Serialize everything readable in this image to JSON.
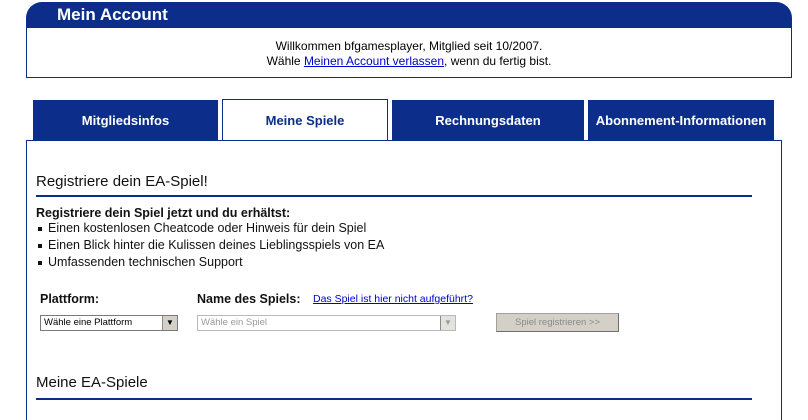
{
  "header": {
    "title": "Mein Account"
  },
  "welcome": {
    "line1": "Willkommen bfgamesplayer, Mitglied seit 10/2007.",
    "line2_prefix": "Wähle ",
    "line2_link": "Meinen Account verlassen",
    "line2_suffix": ", wenn du fertig bist."
  },
  "tabs": [
    {
      "label": "Mitgliedsinfos",
      "active": false
    },
    {
      "label": "Meine Spiele",
      "active": true
    },
    {
      "label": "Rechnungsdaten",
      "active": false
    },
    {
      "label": "Abonnement-Informationen",
      "active": false
    }
  ],
  "register": {
    "heading": "Registriere dein EA-Spiel!",
    "intro": "Registriere dein Spiel jetzt und du erhältst:",
    "benefits": [
      "Einen kostenlosen Cheatcode oder Hinweis für dein Spiel",
      "Einen Blick hinter die Kulissen deines Lieblingsspiels von EA",
      "Umfassenden technischen Support"
    ],
    "platform_label": "Plattform:",
    "platform_value": "Wähle eine Plattform",
    "game_label": "Name des Spiels:",
    "game_missing_link": "Das Spiel ist hier nicht aufgeführt?",
    "game_value": "Wähle ein Spiel",
    "submit_label": "Spiel registrieren >>"
  },
  "my_games": {
    "heading": "Meine EA-Spiele"
  },
  "colors": {
    "brand": "#0c2e8a",
    "link": "#0000cc"
  }
}
